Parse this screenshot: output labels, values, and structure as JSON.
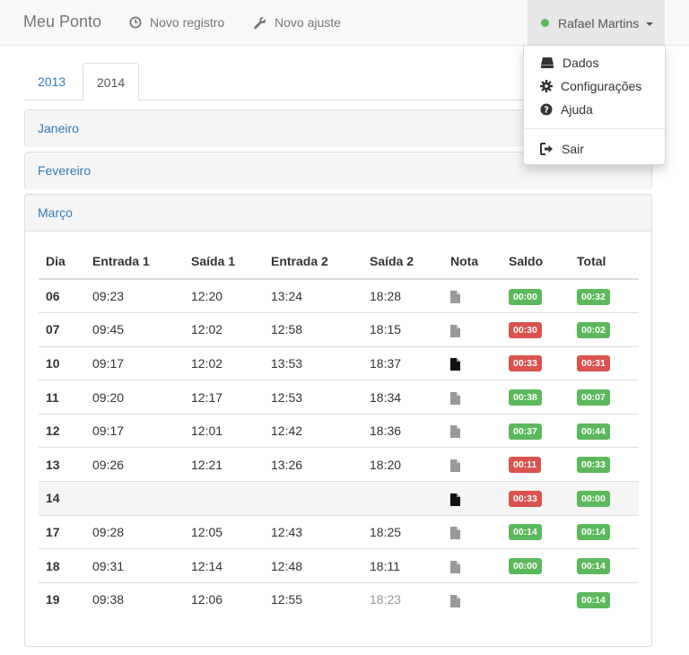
{
  "navbar": {
    "brand": "Meu Ponto",
    "links": [
      {
        "label": "Novo registro",
        "icon": "clock-icon"
      },
      {
        "label": "Novo ajuste",
        "icon": "wrench-icon"
      }
    ],
    "user": {
      "name": "Rafael Martins",
      "status_color": "#5cb85c"
    }
  },
  "user_menu": {
    "items": [
      {
        "label": "Dados",
        "icon": "hdd-icon"
      },
      {
        "label": "Configurações",
        "icon": "gear-icon"
      },
      {
        "label": "Ajuda",
        "icon": "question-icon"
      },
      {
        "label": "Sair",
        "icon": "logout-icon"
      }
    ]
  },
  "tabs": [
    {
      "label": "2013",
      "active": false
    },
    {
      "label": "2014",
      "active": true
    }
  ],
  "months": [
    {
      "label": "Janeiro",
      "expanded": false
    },
    {
      "label": "Fevereiro",
      "expanded": false
    },
    {
      "label": "Março",
      "expanded": true
    }
  ],
  "table": {
    "headers": [
      "Dia",
      "Entrada 1",
      "Saída 1",
      "Entrada 2",
      "Saída 2",
      "Nota",
      "Saldo",
      "Total"
    ],
    "rows": [
      {
        "dia": "06",
        "e1": "09:23",
        "s1": "12:20",
        "e2": "13:24",
        "s2": "18:28",
        "note": "empty",
        "saldo": "00:00",
        "saldo_type": "success",
        "total": "00:32",
        "total_type": "success"
      },
      {
        "dia": "07",
        "e1": "09:45",
        "s1": "12:02",
        "e2": "12:58",
        "s2": "18:15",
        "note": "empty",
        "saldo": "00:30",
        "saldo_type": "danger",
        "total": "00:02",
        "total_type": "success"
      },
      {
        "dia": "10",
        "e1": "09:17",
        "s1": "12:02",
        "e2": "13:53",
        "s2": "18:37",
        "note": "filled",
        "saldo": "00:33",
        "saldo_type": "danger",
        "total": "00:31",
        "total_type": "danger"
      },
      {
        "dia": "11",
        "e1": "09:20",
        "s1": "12:17",
        "e2": "12:53",
        "s2": "18:34",
        "note": "empty",
        "saldo": "00:38",
        "saldo_type": "success",
        "total": "00:07",
        "total_type": "success"
      },
      {
        "dia": "12",
        "e1": "09:17",
        "s1": "12:01",
        "e2": "12:42",
        "s2": "18:36",
        "note": "empty",
        "saldo": "00:37",
        "saldo_type": "success",
        "total": "00:44",
        "total_type": "success"
      },
      {
        "dia": "13",
        "e1": "09:26",
        "s1": "12:21",
        "e2": "13:26",
        "s2": "18:20",
        "note": "empty",
        "saldo": "00:11",
        "saldo_type": "danger",
        "total": "00:33",
        "total_type": "success"
      },
      {
        "dia": "14",
        "e1": "",
        "s1": "",
        "e2": "",
        "s2": "",
        "note": "filled",
        "saldo": "00:33",
        "saldo_type": "danger",
        "total": "00:00",
        "total_type": "success",
        "highlight": true
      },
      {
        "dia": "17",
        "e1": "09:28",
        "s1": "12:05",
        "e2": "12:43",
        "s2": "18:25",
        "note": "empty",
        "saldo": "00:14",
        "saldo_type": "success",
        "total": "00:14",
        "total_type": "success"
      },
      {
        "dia": "18",
        "e1": "09:31",
        "s1": "12:14",
        "e2": "12:48",
        "s2": "18:11",
        "note": "empty",
        "saldo": "00:00",
        "saldo_type": "success",
        "total": "00:14",
        "total_type": "success"
      },
      {
        "dia": "19",
        "e1": "09:38",
        "s1": "12:06",
        "e2": "12:55",
        "s2": "18:23",
        "s2_muted": true,
        "note": "empty",
        "saldo": "",
        "saldo_type": "",
        "total": "00:14",
        "total_type": "success"
      }
    ]
  }
}
